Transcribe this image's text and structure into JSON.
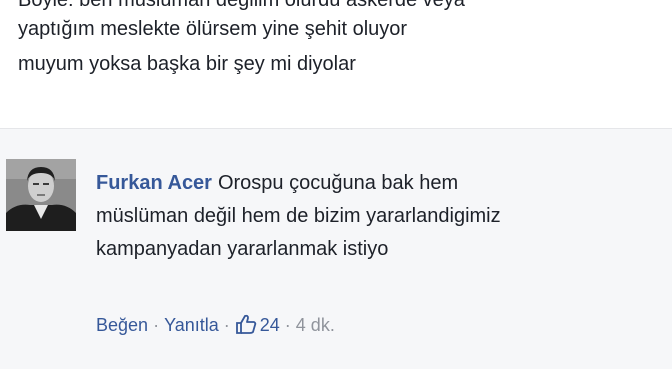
{
  "post": {
    "lines": [
      "Böyle: ben müslüman değilim ölurdu askerde veya",
      "yaptığım meslekte ölürsem yine şehit oluyor",
      "muyum yoksa başka bir şey mi diyolar"
    ]
  },
  "comment": {
    "author": "Furkan Acer",
    "lines": [
      "Orospu çocuğuna bak hem",
      "müslüman değil hem de bizim yararlandigimiz",
      "kampanyadan yararlanmak istiyo"
    ],
    "actions": {
      "like_label": "Beğen",
      "reply_label": "Yanıtla",
      "like_count": "24",
      "separator": "·",
      "timestamp": "4 dk."
    },
    "icons": {
      "like": "thumbs-up-icon"
    }
  },
  "colors": {
    "author": "#365899",
    "link": "#365899",
    "muted": "#90949c",
    "text": "#1d2129",
    "comment_bg": "#f6f7f9"
  }
}
